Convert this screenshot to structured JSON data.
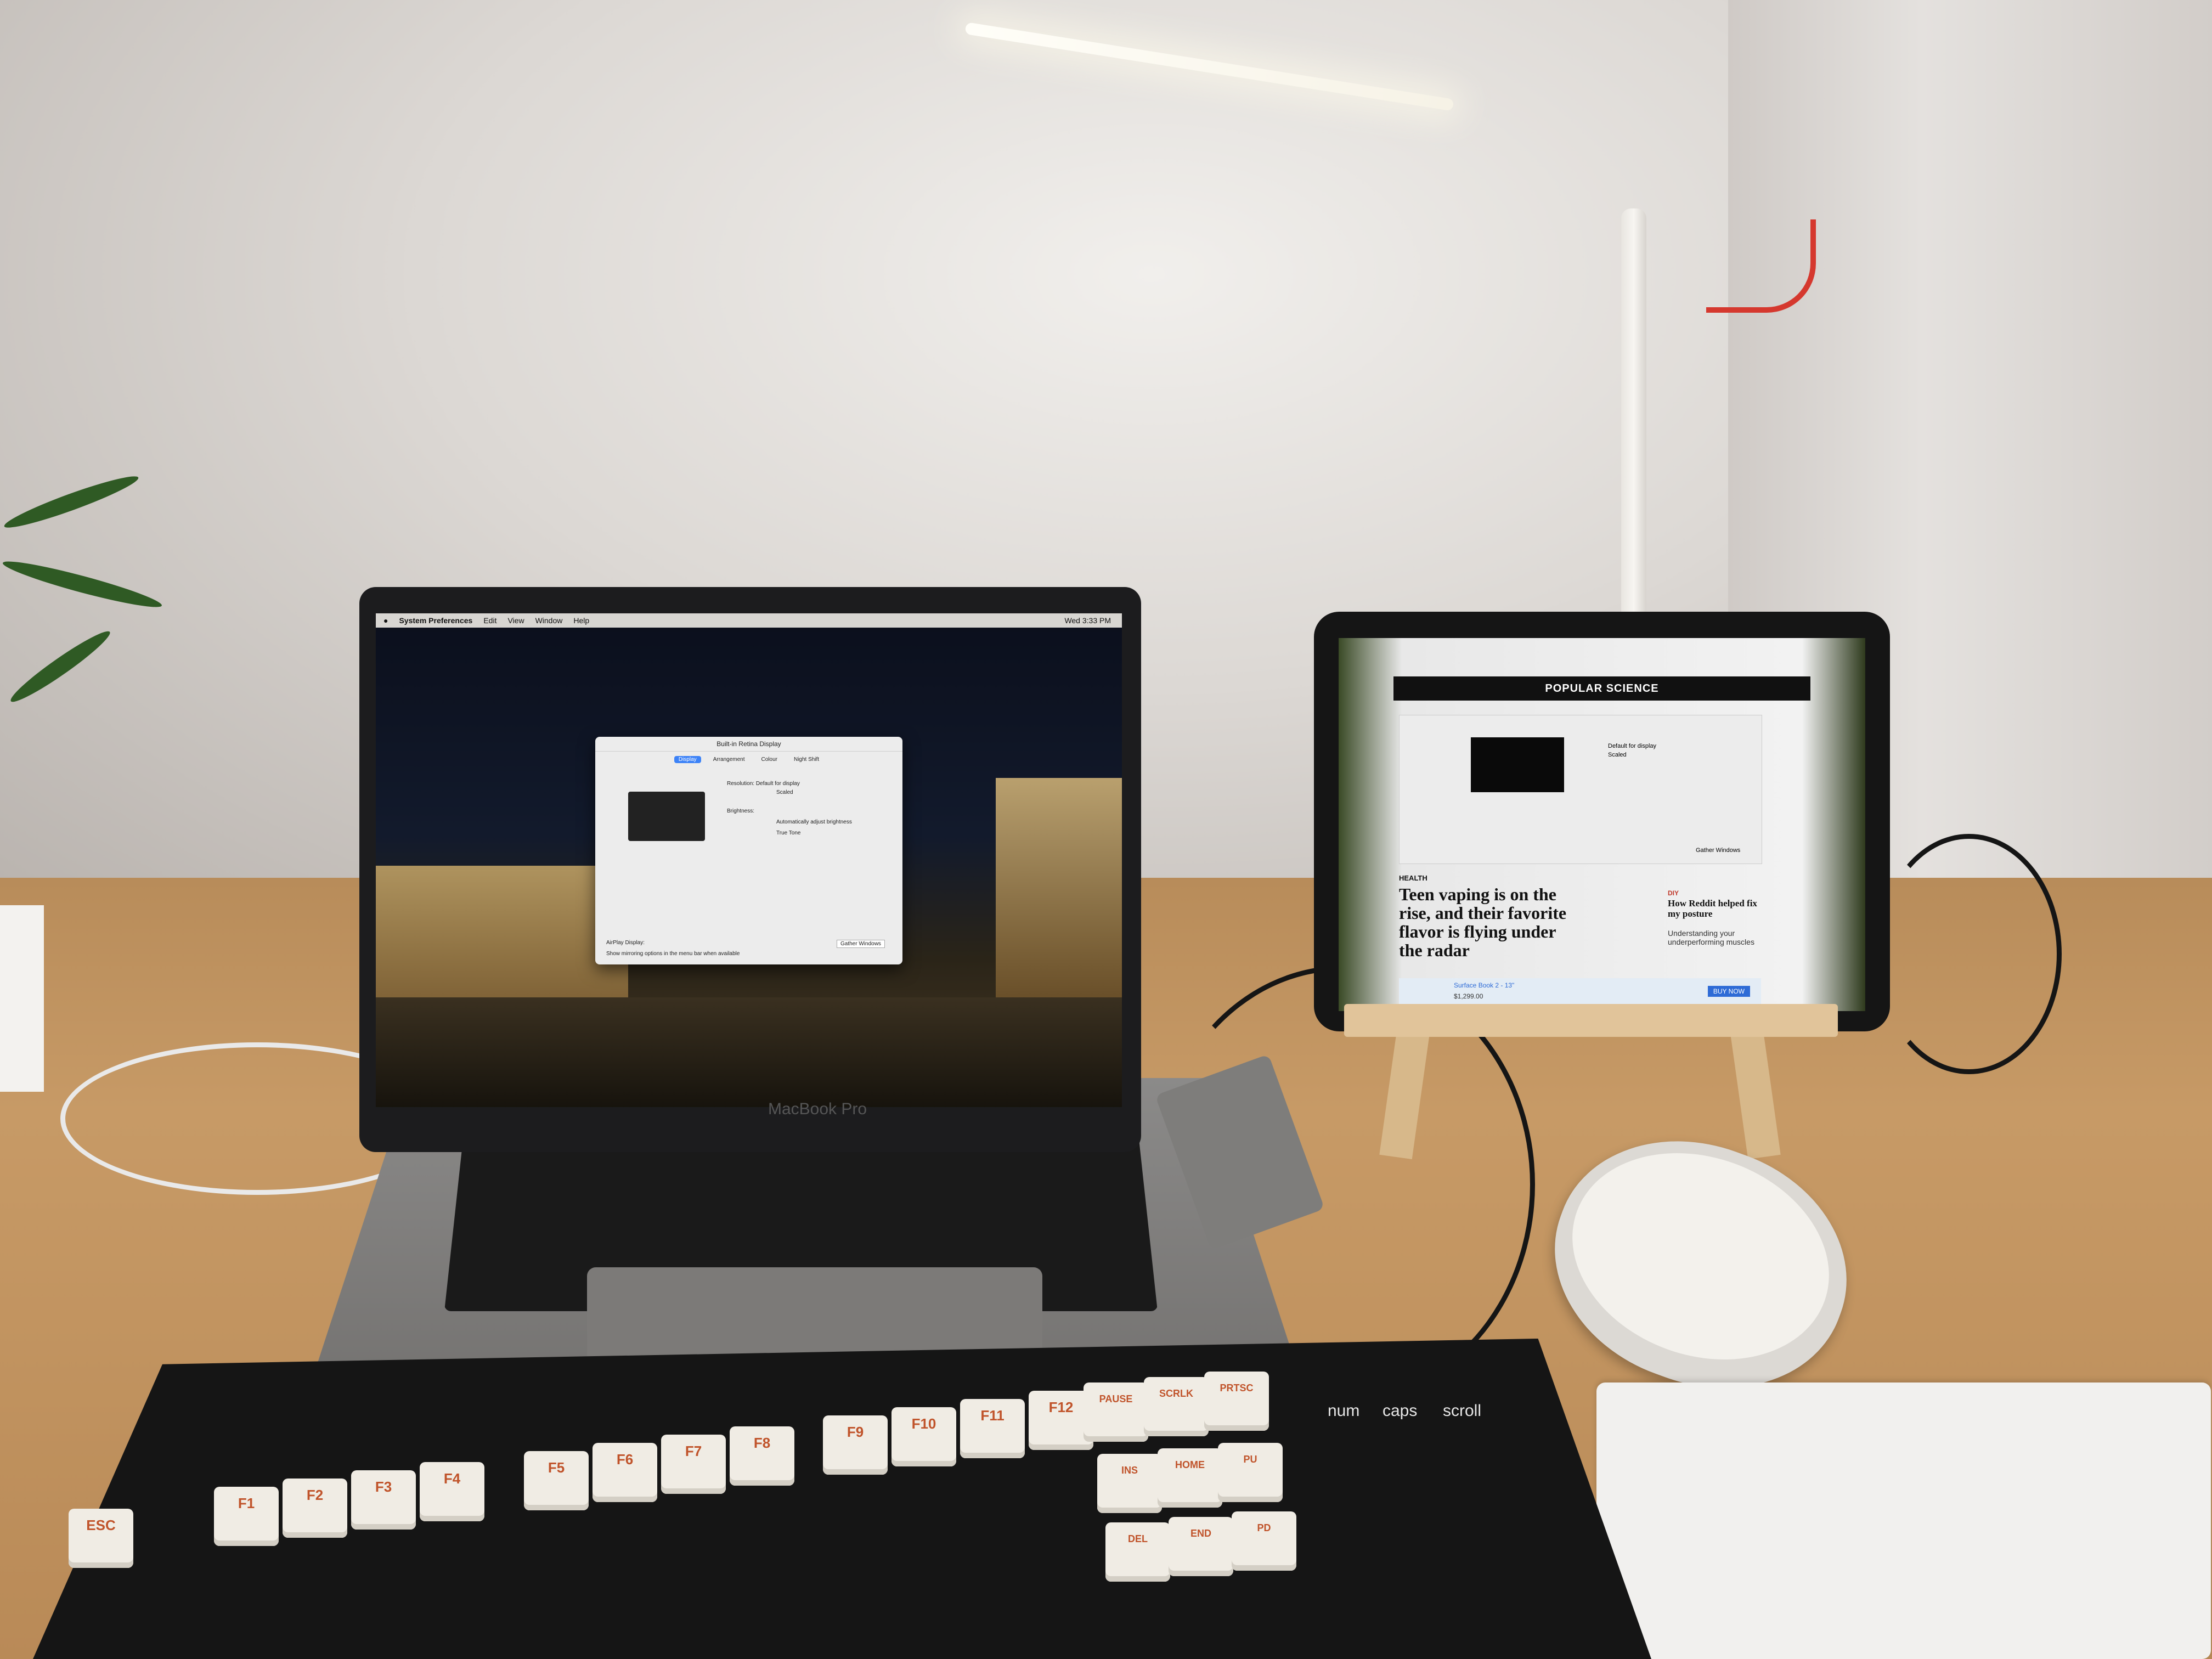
{
  "scene": "desk",
  "macbook": {
    "brand": "MacBook Pro",
    "menubar": {
      "app": "System Preferences",
      "items": [
        "Edit",
        "View",
        "Window",
        "Help"
      ],
      "clock": "Wed 3:33 PM"
    },
    "dialog": {
      "title": "Built-in Retina Display",
      "tabs": [
        "Display",
        "Arrangement",
        "Colour",
        "Night Shift"
      ],
      "selected_tab": "Display",
      "resolution_label": "Resolution:",
      "resolution_options": [
        "Default for display",
        "Scaled"
      ],
      "brightness_label": "Brightness:",
      "auto_brightness": "Automatically adjust brightness",
      "true_tone": "True Tone",
      "airplay_label": "AirPlay Display:",
      "mirroring_option": "Show mirroring options in the menu bar when available",
      "gather_button": "Gather Windows"
    }
  },
  "ipad": {
    "site": "POPULAR SCIENCE",
    "pref_resolution_options": [
      "Default for display",
      "Scaled"
    ],
    "pref_gather_button": "Gather Windows",
    "section": "HEALTH",
    "headline": "Teen vaping is on the rise, and their favorite flavor is flying under the radar",
    "side_tag": "DIY",
    "side_headline": "How Reddit helped fix my posture",
    "side_sub": "Understanding your underperforming muscles",
    "ad_title": "Surface Book 2 - 13\"",
    "ad_price": "$1,299.00",
    "ad_button": "BUY NOW"
  },
  "keyboard": {
    "function_keys": [
      "ESC",
      "F1",
      "F2",
      "F3",
      "F4",
      "F5",
      "F6",
      "F7",
      "F8",
      "F9",
      "F10",
      "F11",
      "F12",
      "PAUSE",
      "SCRLK",
      "PRTSC"
    ],
    "nav_keys": [
      "INS",
      "HOME",
      "PU",
      "DEL",
      "END",
      "PD"
    ],
    "indicators": [
      "num",
      "caps",
      "scroll"
    ]
  },
  "colors": {
    "desk": "#c79a66",
    "wall": "#e4e1de",
    "lamp_cable": "#d5382e",
    "keycap": "#f0ece4",
    "legend": "#c0532a"
  }
}
